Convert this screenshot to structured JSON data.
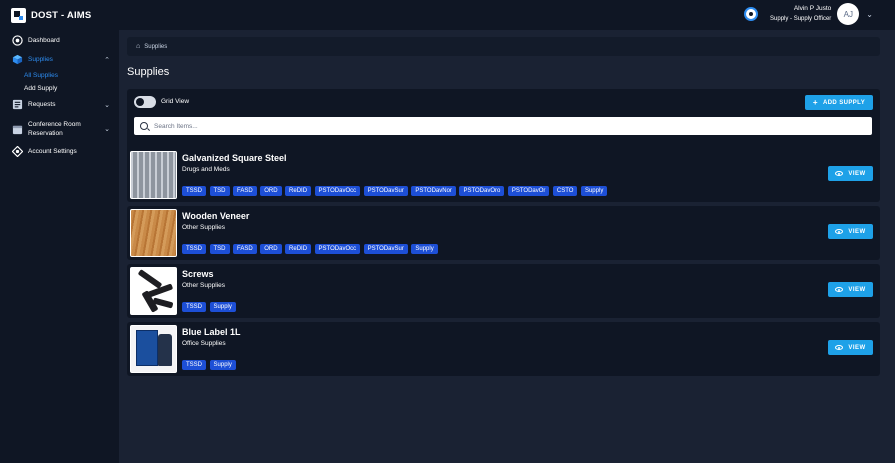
{
  "app": {
    "brand": "DOST - AIMS"
  },
  "user": {
    "name": "Alvin P Justo",
    "role": "Supply - Supply Officer",
    "initials": "AJ"
  },
  "sidebar": {
    "items": [
      {
        "label": "Dashboard",
        "icon": "dashboard-icon"
      },
      {
        "label": "Supplies",
        "icon": "box-icon",
        "active": true,
        "expanded": true,
        "children": [
          {
            "label": "All Supplies",
            "active": true
          },
          {
            "label": "Add Supply"
          }
        ]
      },
      {
        "label": "Requests",
        "icon": "requests-icon"
      },
      {
        "label": "Conference Room Reservation",
        "icon": "calendar-icon"
      },
      {
        "label": "Account Settings",
        "icon": "settings-icon"
      }
    ]
  },
  "breadcrumb": {
    "current": "Supplies"
  },
  "page": {
    "title": "Supplies",
    "grid_view_label": "Grid View",
    "grid_view_enabled": false,
    "add_button_label": "ADD SUPPLY",
    "search_placeholder": "Search Items..."
  },
  "view_label": "VIEW",
  "supplies": [
    {
      "name": "Galvanized Square Steel",
      "category": "Drugs and Meds",
      "tags": [
        "TSSD",
        "TSD",
        "FASD",
        "ORD",
        "ReDID",
        "PSTODavOcc",
        "PSTODavSur",
        "PSTODavNor",
        "PSTODavOro",
        "PSTODavOr",
        "CSTO",
        "Supply"
      ]
    },
    {
      "name": "Wooden Veneer",
      "category": "Other Supplies",
      "tags": [
        "TSSD",
        "TSD",
        "FASD",
        "ORD",
        "ReDID",
        "PSTODavOcc",
        "PSTODavSur",
        "Supply"
      ]
    },
    {
      "name": "Screws",
      "category": "Other Supplies",
      "tags": [
        "TSSD",
        "Supply"
      ]
    },
    {
      "name": "Blue Label 1L",
      "category": "Office Supplies",
      "tags": [
        "TSSD",
        "Supply"
      ]
    }
  ],
  "colors": {
    "background": "#1a2233",
    "panel": "#0f1624",
    "accent": "#1ea1e8",
    "tag": "#1d4fd6",
    "active_link": "#2d8cf0"
  }
}
